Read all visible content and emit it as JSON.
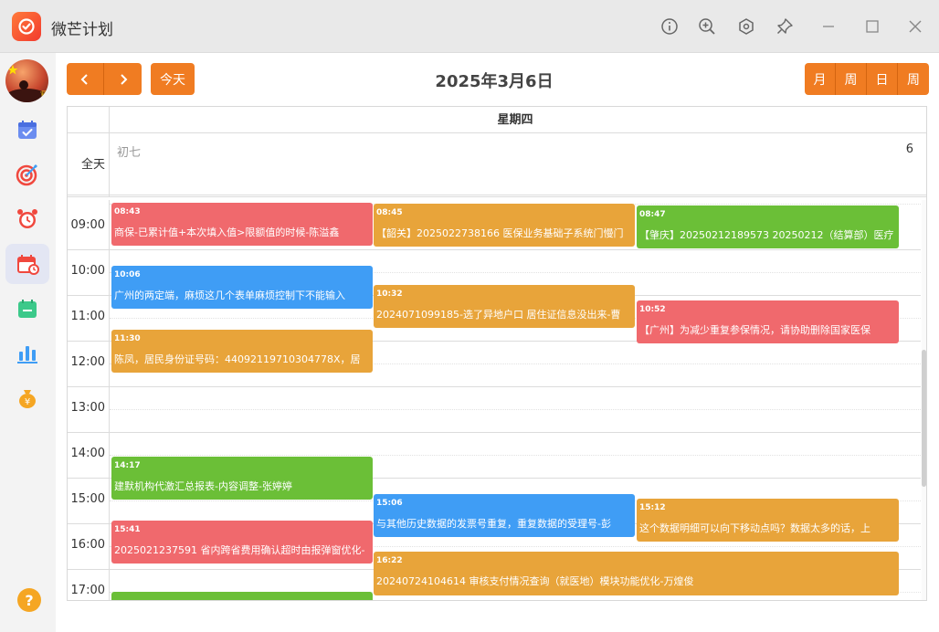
{
  "app": {
    "title": "微芒计划"
  },
  "sidebar": {
    "items": [
      {
        "icon": "calendar-check-icon",
        "color": "#5b8def"
      },
      {
        "icon": "target-icon",
        "color": "#f0483e"
      },
      {
        "icon": "alarm-clock-icon",
        "color": "#f0483e"
      },
      {
        "icon": "calendar-schedule-icon",
        "color": "#f0483e"
      },
      {
        "icon": "calendar-note-icon",
        "color": "#3cc98a"
      },
      {
        "icon": "bar-chart-icon",
        "color": "#3f9df5"
      },
      {
        "icon": "money-bag-icon",
        "color": "#f5a623"
      }
    ],
    "help_label": "?"
  },
  "toolbar": {
    "today_label": "今天",
    "date_title": "2025年3月6日",
    "views": [
      "月",
      "周",
      "日",
      "周"
    ]
  },
  "calendar": {
    "weekday": "星期四",
    "allday_label": "全天",
    "lunar": "初七",
    "day_number": "6",
    "hours": [
      "09:00",
      "10:00",
      "11:00",
      "12:00",
      "13:00",
      "14:00",
      "15:00",
      "16:00",
      "17:00"
    ],
    "events": [
      {
        "time": "08:43",
        "title": "商保-已累计值+本次填入值>限额值的时候-陈溢鑫",
        "color": "red"
      },
      {
        "time": "08:45",
        "title": "【韶关】2025022738166 医保业务基础子系统门慢门",
        "color": "orange"
      },
      {
        "time": "08:47",
        "title": "【肇庆】20250212189573 20250212（结算部）医疗",
        "color": "green"
      },
      {
        "time": "10:06",
        "title": "广州的两定端，麻烦这几个表单麻烦控制下不能输入",
        "color": "blue"
      },
      {
        "time": "10:32",
        "title": "2024071099185-选了异地户口 居住证信息没出来-曹",
        "color": "orange"
      },
      {
        "time": "10:52",
        "title": "【广州】为减少重复参保情况，请协助删除国家医保",
        "color": "red"
      },
      {
        "time": "11:30",
        "title": "陈凤，居民身份证号码：44092119710304778X，居",
        "color": "orange"
      },
      {
        "time": "14:17",
        "title": "建默机构代激汇总报表-内容调整-张婷婷",
        "color": "green"
      },
      {
        "time": "15:06",
        "title": "与其他历史数据的发票号重复，重复数据的受理号-彭",
        "color": "blue"
      },
      {
        "time": "15:12",
        "title": "这个数据明细可以向下移动点吗？数据太多的话，上",
        "color": "orange"
      },
      {
        "time": "15:41",
        "title": "2025021237591 省内跨省费用确认超时由报弹窗优化-",
        "color": "red"
      },
      {
        "time": "16:22",
        "title": "20240724104614 审核支付情况查询（就医地）模块功能优化-万煌俊",
        "color": "orange"
      },
      {
        "time": "",
        "title": "",
        "color": "green"
      }
    ]
  }
}
